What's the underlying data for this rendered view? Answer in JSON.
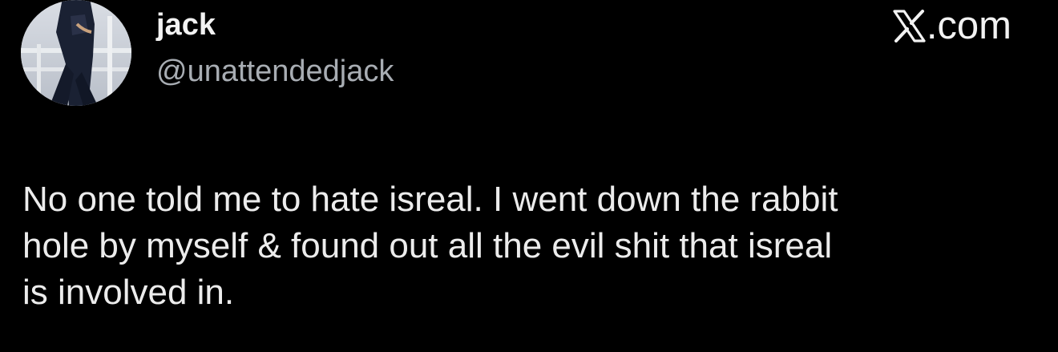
{
  "author": {
    "display_name": "jack",
    "handle": "@unattendedjack"
  },
  "brand": {
    "label": ".com",
    "icon": "x-logo-icon"
  },
  "tweet": {
    "lines": [
      "No one told me to hate isreal. I went down the rabbit",
      "hole by myself & found out all the evil shit that isreal",
      "is involved in."
    ]
  },
  "colors": {
    "background": "#000000",
    "primary_text": "#e7e9ea",
    "secondary_text": "#a8adb3"
  }
}
